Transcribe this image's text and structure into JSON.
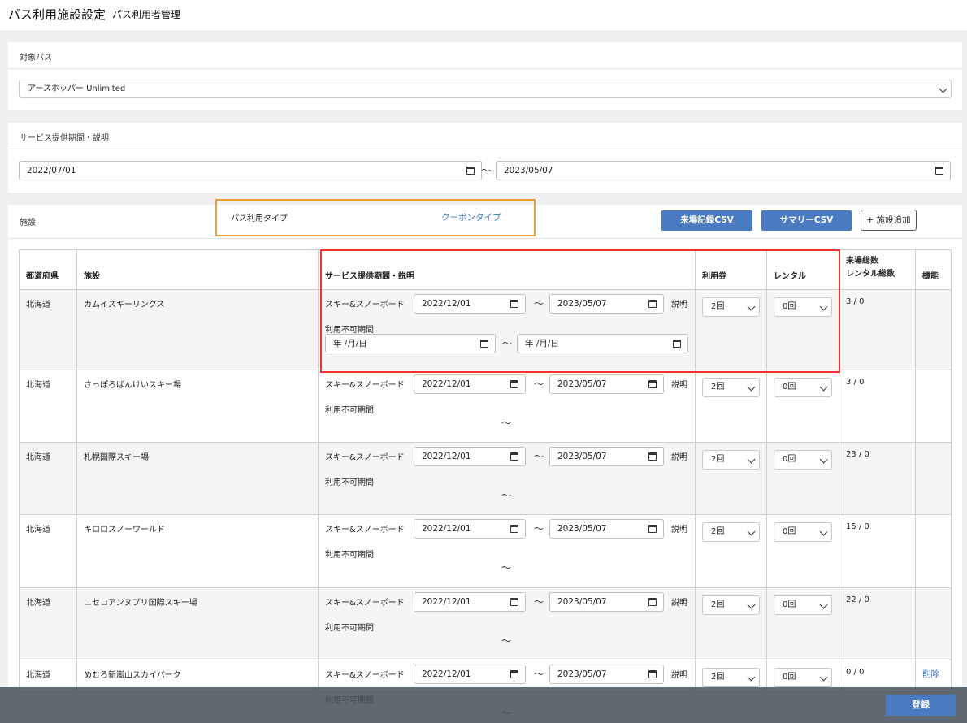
{
  "header": {
    "title": "パス利用施設設定",
    "subtitle": "パス利用者管理"
  },
  "target_pass": {
    "label": "対象パス",
    "selected": "アースホッパー Unlimited"
  },
  "service_period": {
    "label": "サービス提供期間・説明",
    "start": "2022/07/01",
    "end": "2023/05/07",
    "tilde": "〜"
  },
  "facilities": {
    "label": "施設",
    "pass_type_label": "パス利用タイプ",
    "pass_type_value": "クーポンタイプ",
    "btn_visit_csv": "来場記録CSV",
    "btn_summary_csv": "サマリーCSV",
    "btn_add": "+ 施設追加",
    "columns": {
      "prefecture": "都道府県",
      "facility": "施設",
      "service": "サービス提供期間・説明",
      "coupon": "利用券",
      "rental": "レンタル",
      "visits_line1": "来場総数",
      "visits_line2": "レンタル総数",
      "functions": "機能"
    },
    "service_label": "スキー&スノーボード",
    "desc_label": "説明",
    "unavail_label": "利用不可期間",
    "date_placeholder": "年 /月/日",
    "rows": [
      {
        "prefecture": "北海道",
        "facility": "カムイスキーリンクス",
        "start": "2022/12/01",
        "end": "2023/05/07",
        "coupon": "2回",
        "rental": "0回",
        "totals": "3 / 0",
        "action": ""
      },
      {
        "prefecture": "北海道",
        "facility": "さっぽろばんけいスキー場",
        "start": "2022/12/01",
        "end": "2023/05/07",
        "coupon": "2回",
        "rental": "0回",
        "totals": "3 / 0",
        "action": ""
      },
      {
        "prefecture": "北海道",
        "facility": "札幌国際スキー場",
        "start": "2022/12/01",
        "end": "2023/05/07",
        "coupon": "2回",
        "rental": "0回",
        "totals": "23 / 0",
        "action": ""
      },
      {
        "prefecture": "北海道",
        "facility": "キロロスノーワールド",
        "start": "2022/12/01",
        "end": "2023/05/07",
        "coupon": "2回",
        "rental": "0回",
        "totals": "15 / 0",
        "action": ""
      },
      {
        "prefecture": "北海道",
        "facility": "ニセコアンヌプリ国際スキー場",
        "start": "2022/12/01",
        "end": "2023/05/07",
        "coupon": "2回",
        "rental": "0回",
        "totals": "22 / 0",
        "action": ""
      },
      {
        "prefecture": "北海道",
        "facility": "めむろ新嵐山スカイパーク",
        "start": "2022/12/01",
        "end": "2023/05/07",
        "coupon": "2回",
        "rental": "0回",
        "totals": "0 / 0",
        "action": "削除"
      }
    ]
  },
  "footer": {
    "register": "登録"
  }
}
